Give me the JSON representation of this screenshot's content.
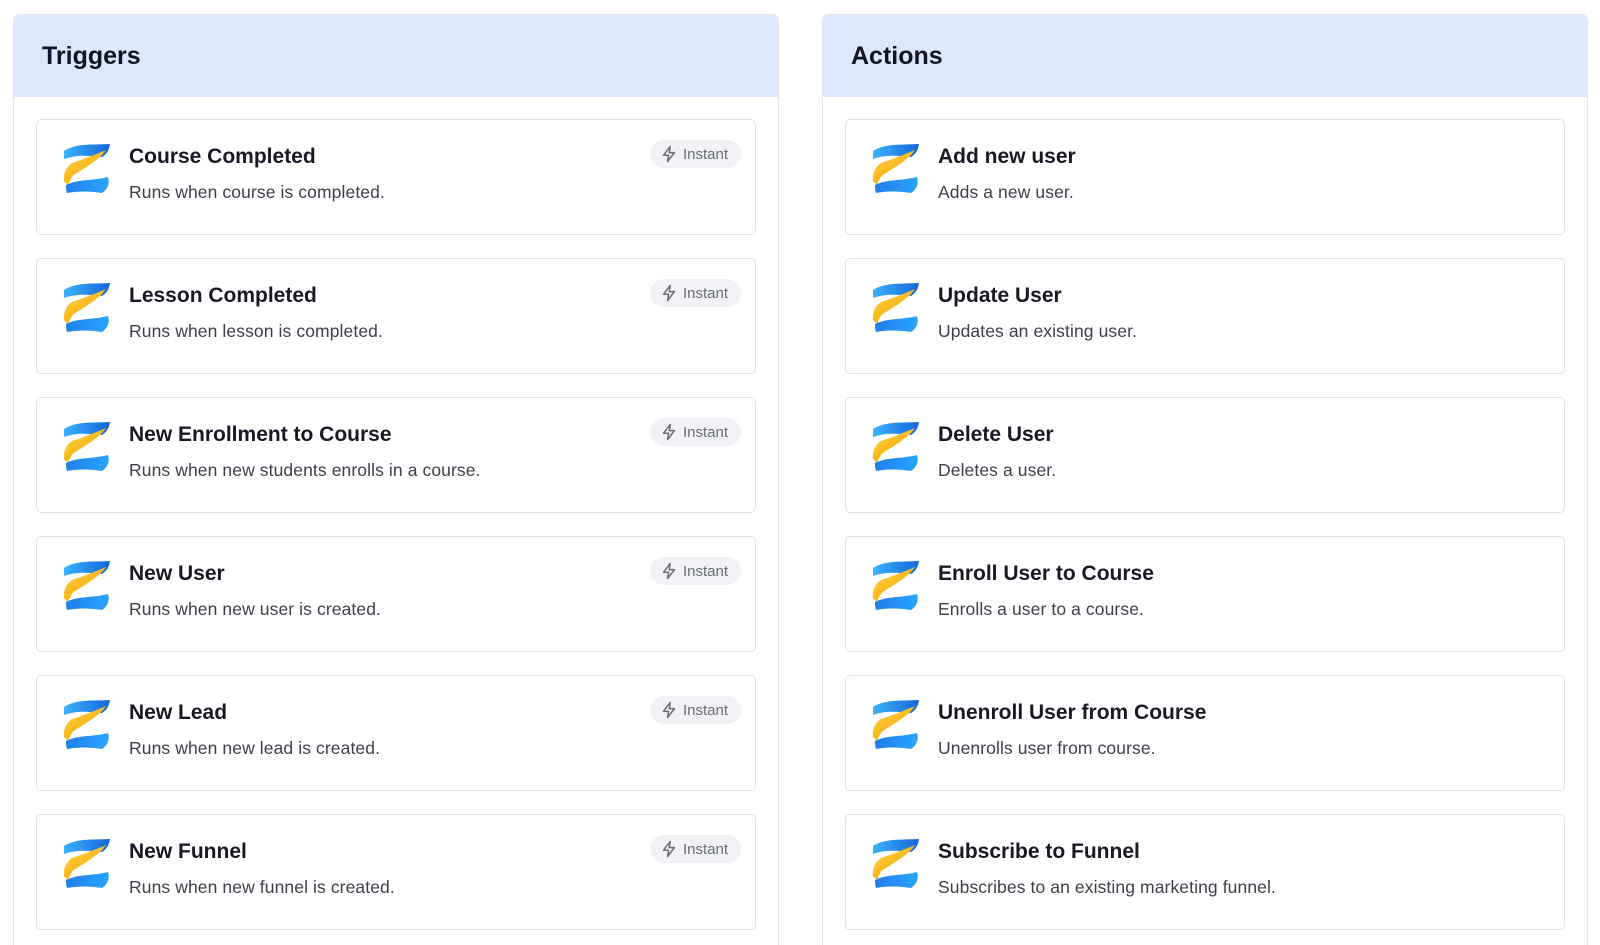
{
  "colors": {
    "header_bg": "#dbe8fd",
    "logo_blue": "#1d8cf0",
    "logo_yellow": "#f7c21e",
    "badge_bg": "#f1f2f5"
  },
  "triggers": {
    "title": "Triggers",
    "items": [
      {
        "title": "Course Completed",
        "description": "Runs when course is completed.",
        "badge": "Instant",
        "icon": "zapier-z-app-logo"
      },
      {
        "title": "Lesson Completed",
        "description": "Runs when lesson is completed.",
        "badge": "Instant",
        "icon": "zapier-z-app-logo"
      },
      {
        "title": "New Enrollment to Course",
        "description": "Runs when new students enrolls in a course.",
        "badge": "Instant",
        "icon": "zapier-z-app-logo"
      },
      {
        "title": "New User",
        "description": "Runs when new user is created.",
        "badge": "Instant",
        "icon": "zapier-z-app-logo"
      },
      {
        "title": "New Lead",
        "description": "Runs when new lead is created.",
        "badge": "Instant",
        "icon": "zapier-z-app-logo"
      },
      {
        "title": "New Funnel",
        "description": "Runs when new funnel is created.",
        "badge": "Instant",
        "icon": "zapier-z-app-logo"
      }
    ]
  },
  "actions": {
    "title": "Actions",
    "items": [
      {
        "title": "Add new user",
        "description": "Adds a new user.",
        "icon": "zapier-z-app-logo"
      },
      {
        "title": "Update User",
        "description": "Updates an existing user.",
        "icon": "zapier-z-app-logo"
      },
      {
        "title": "Delete User",
        "description": "Deletes a user.",
        "icon": "zapier-z-app-logo"
      },
      {
        "title": "Enroll User to Course",
        "description": "Enrolls a user to a course.",
        "icon": "zapier-z-app-logo"
      },
      {
        "title": "Unenroll User from Course",
        "description": "Unenrolls user from course.",
        "icon": "zapier-z-app-logo"
      },
      {
        "title": "Subscribe to Funnel",
        "description": "Subscribes to an existing marketing funnel.",
        "icon": "zapier-z-app-logo"
      }
    ]
  }
}
